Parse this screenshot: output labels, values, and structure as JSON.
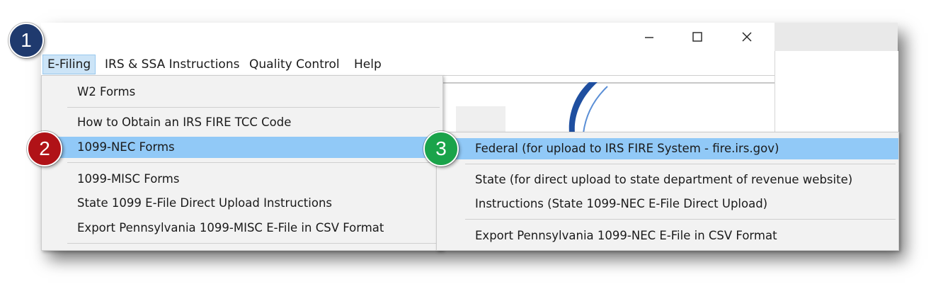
{
  "window": {
    "minimize_icon": "minimize-icon",
    "maximize_icon": "maximize-icon",
    "close_icon": "close-icon"
  },
  "menubar": {
    "items": [
      "E-Filing",
      "IRS & SSA Instructions",
      "Quality Control",
      "Help"
    ]
  },
  "efiling_menu": {
    "items": [
      "W2 Forms",
      "How to Obtain an IRS FIRE TCC Code",
      "1099-NEC Forms",
      "1099-MISC Forms",
      "State 1099 E-File Direct Upload Instructions",
      "Export Pennsylvania 1099-MISC E-File in CSV Format"
    ]
  },
  "nec_submenu": {
    "items": [
      "Federal (for upload to IRS FIRE System - fire.irs.gov)",
      "State (for direct upload to state department of revenue website)",
      "Instructions (State 1099-NEC E-File Direct Upload)",
      "Export Pennsylvania 1099-NEC E-File in CSV Format"
    ]
  },
  "badges": [
    {
      "label": "1",
      "color": "#1f3a6e"
    },
    {
      "label": "2",
      "color": "#b01217"
    },
    {
      "label": "3",
      "color": "#1aa34a"
    }
  ],
  "colors": {
    "highlight": "#91c9f7",
    "menu_bg": "#f2f2f2",
    "active_menubar": "#cce4f7"
  }
}
